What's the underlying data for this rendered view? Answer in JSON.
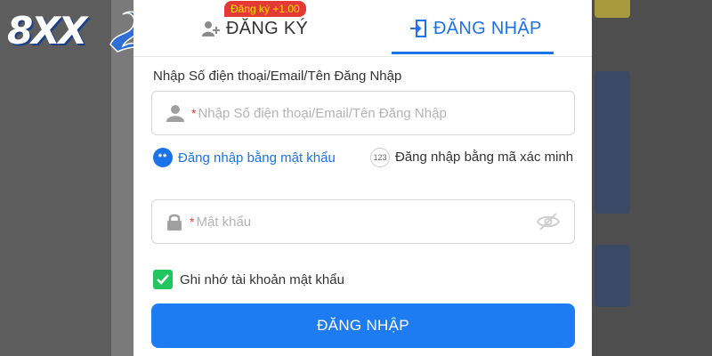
{
  "logo": {
    "text": "8XX"
  },
  "tabs": {
    "register_label": "ĐĂNG KÝ",
    "register_badge": "Đăng ký +1.00",
    "login_label": "ĐĂNG NHẬP"
  },
  "form": {
    "username_label": "Nhập Số điện thoại/Email/Tên Đăng Nhập",
    "username_required": "*",
    "username_placeholder": "Nhập Số điện thoại/Email/Tên Đăng Nhập",
    "option_password": "Đăng nhập bằng mật khẩu",
    "option_password_icon": "**",
    "option_code": "Đăng nhập bằng mã xác minh",
    "option_code_icon": "123",
    "password_required": "*",
    "password_placeholder": "Mật khẩu",
    "remember_label": "Ghi nhớ tài khoản mật khẩu",
    "remember_checked": true,
    "login_button": "ĐĂNG NHẬP"
  },
  "colors": {
    "accent": "#1a73e8",
    "button": "#1e7cf2",
    "badge_bg": "#e53935",
    "badge_text": "#ffe000",
    "checkbox": "#22c55e"
  },
  "icons": [
    "add-user-icon",
    "login-door-icon",
    "user-icon",
    "lock-icon",
    "eye-off-icon",
    "checkmark-icon",
    "dragon-logo-icon"
  ]
}
